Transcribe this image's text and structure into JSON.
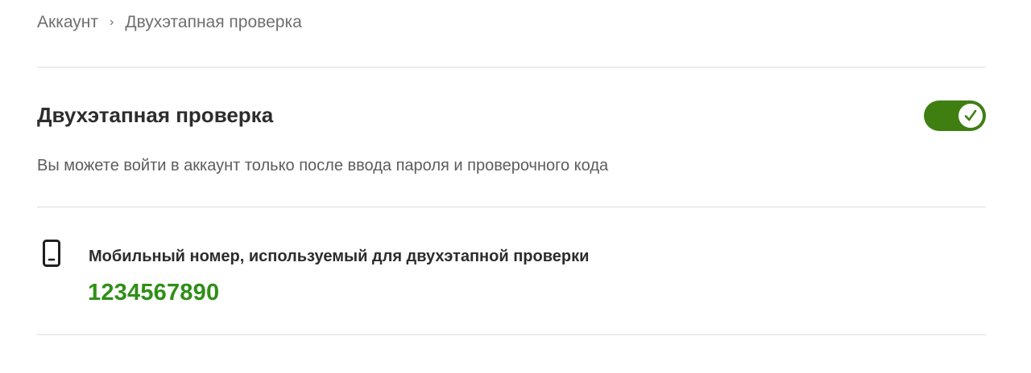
{
  "breadcrumb": {
    "root": "Аккаунт",
    "separator": "›",
    "current": "Двухэтапная проверка"
  },
  "two_step": {
    "title": "Двухэтапная проверка",
    "description": "Вы можете войти в аккаунт только после ввода пароля и проверочного кода",
    "toggle": {
      "enabled": true,
      "icon": "checkmark-icon",
      "color": "#3f7f12"
    }
  },
  "phone": {
    "icon": "mobile-phone-icon",
    "label": "Мобильный номер, используемый для двухэтапной проверки",
    "number": "1234567890",
    "number_color": "#2f8f17"
  }
}
